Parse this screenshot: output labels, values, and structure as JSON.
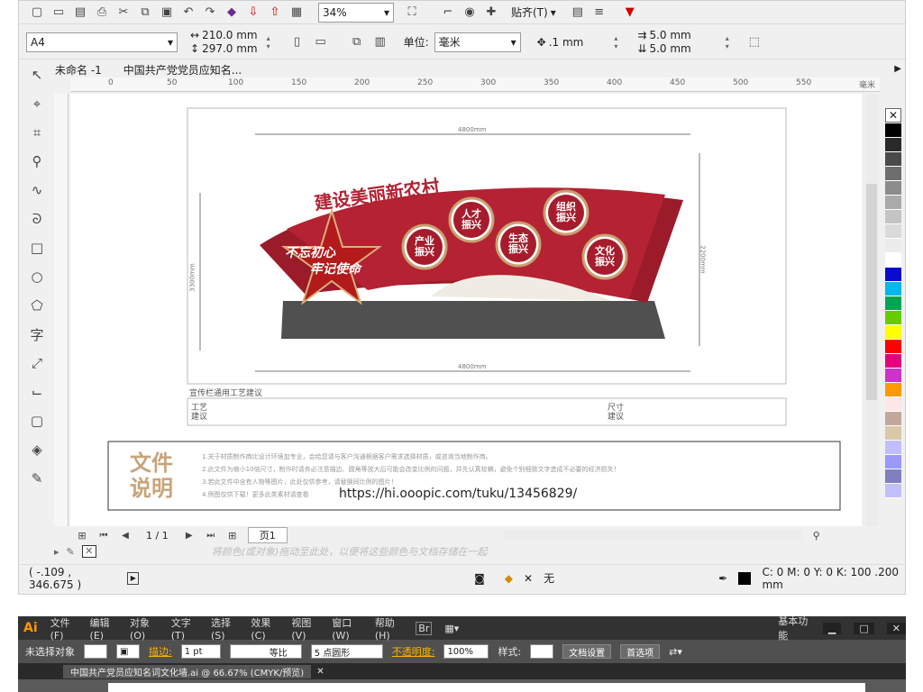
{
  "toolbar1": {
    "zoom": "34%",
    "snap": "贴齐(T)"
  },
  "toolbar2": {
    "paper": "A4",
    "width": "210.0 mm",
    "height": "297.0 mm",
    "unit_label": "单位:",
    "unit": "毫米",
    "nudge": ".1 mm",
    "dup_x": "5.0 mm",
    "dup_y": "5.0 mm"
  },
  "tabs": [
    "未命名 -1",
    "中国共产党党员应知名..."
  ],
  "ruler": [
    "0",
    "50",
    "100",
    "150",
    "200",
    "250",
    "300",
    "350",
    "400",
    "450",
    "500",
    "550",
    "毫米"
  ],
  "palette": [
    "#000000",
    "#2a2a2a",
    "#4a4a4a",
    "#6e6e6e",
    "#8c8c8c",
    "#aaaaaa",
    "#c4c4c4",
    "#dadada",
    "#ececec",
    "#ffffff",
    "#0b0bcf",
    "#00b7ee",
    "#00a650",
    "#66cc00",
    "#ffff00",
    "#ff0000",
    "#e4007f",
    "#cc33cc",
    "#ff9900",
    "#ffe6e6",
    "#c2a89c",
    "#d9c8a8",
    "#bfbfff",
    "#9999ff",
    "#8080c0",
    "#c0c0ff"
  ],
  "pagebar": {
    "pages": "1 / 1",
    "page_label": "页1"
  },
  "status2_hint": "将颜色(或对象)拖动至此处，以便将这些颜色与文档存储在一起",
  "status": {
    "coords": "( -.109 , 346.675 )",
    "fill": "无",
    "outline": "C: 0 M: 0 Y: 0 K: 100  .200 mm"
  },
  "design": {
    "title_top": "建设美丽新农村",
    "slogan1": "不忘初心",
    "slogan2": "牢记使命",
    "circles": [
      "人才振兴",
      "产业振兴",
      "生态振兴",
      "组织振兴",
      "文化振兴"
    ],
    "dim_w": "4800mm",
    "dim_h": "2200mm",
    "dim_h2": "3300mm",
    "notes_title": "宣传栏通用工艺建议",
    "craft_label": "工艺建议",
    "size_label": "尺寸建议",
    "file_desc_title": "文件说明",
    "file_desc_lines": [
      "1.关于材质制作商比设计环境加专业，会给您请与客户沟通根据客户需求选择材质，或咨询当地制作商。",
      "2.此文件为缩小10倍尺寸，制作时请务必注意描边、圆角等放大后可能会改变比例的问题，并先认真校稿，避免个别细致文字造成不必要的经济损失！",
      "3.若此文件中含有人物等图片，此处仅供参考，请替换同比例的图片！",
      "4.例图仅供下载！更多此类素材请查看"
    ],
    "url": "https://hi.ooopic.com/tuku/13456829/"
  },
  "ai": {
    "logo": "Ai",
    "menus": [
      "文件(F)",
      "编辑(E)",
      "对象(O)",
      "文字(T)",
      "选择(S)",
      "效果(C)",
      "视图(V)",
      "窗口(W)",
      "帮助(H)"
    ],
    "workspace": "基本功能",
    "no_selection": "未选择对象",
    "stroke": "描边:",
    "stroke_val": "1 pt",
    "ratio": "等比",
    "dot": "5 点圆形",
    "opacity": "不透明度:",
    "opacity_val": "100%",
    "style": "样式:",
    "doc_settings": "文档设置",
    "prefs": "首选项",
    "doc_tab": "中国共产党员应知名词文化墙.ai @ 66.67% (CMYK/预览)"
  }
}
